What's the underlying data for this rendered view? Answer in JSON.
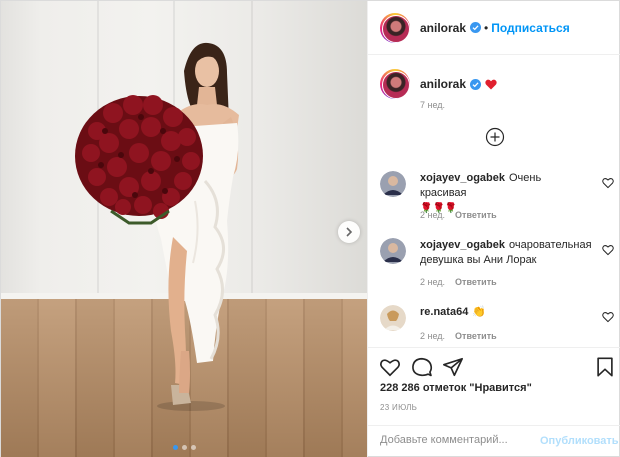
{
  "colors": {
    "accent": "#0095f6",
    "verified": "#3897f0",
    "heart": "#ed4956",
    "muted": "#8e8e8e"
  },
  "header": {
    "username": "anilorak",
    "separator": "•",
    "follow_label": "Подписаться"
  },
  "caption": {
    "username": "anilorak",
    "emoji": "heart",
    "time": "7 нед."
  },
  "comments": [
    {
      "username": "xojayev_ogabek",
      "text": "Очень красивая",
      "emoji": "🌹🌹🌹",
      "time": "2 нед.",
      "reply": "Ответить"
    },
    {
      "username": "xojayev_ogabek",
      "text": "очаровательная девушка вы Ани Лорак",
      "emoji": "",
      "time": "2 нед.",
      "reply": "Ответить"
    },
    {
      "username": "re.nata64",
      "text": "",
      "emoji": "👏",
      "time": "2 нед.",
      "reply": "Ответить"
    }
  ],
  "actions": {
    "icons": [
      "heart-icon",
      "comment-icon",
      "share-icon",
      "bookmark-icon"
    ]
  },
  "likes": "228 286 отметок \"Нравится\"",
  "date": "23 ИЮЛЬ",
  "add_comment": {
    "placeholder": "Добавьте комментарий...",
    "publish_label": "Опубликовать"
  },
  "carousel": {
    "slides": 3,
    "active": 1
  }
}
